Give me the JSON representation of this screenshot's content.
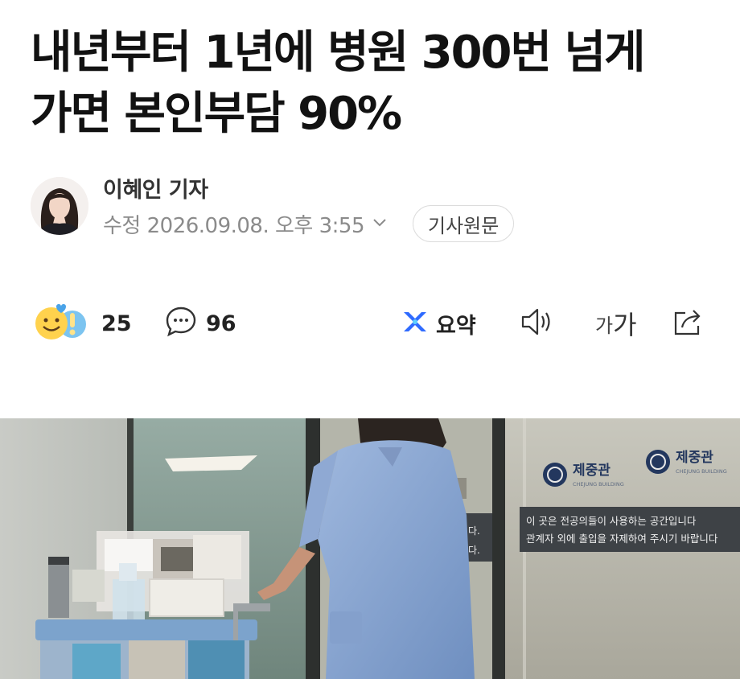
{
  "article": {
    "headline_line1": "내년부터 1년에 병원 300번 넘게",
    "headline_line2": "가면 본인부담 90%"
  },
  "byline": {
    "reporter": "이혜인 기자",
    "updated": "수정 2026.09.08. 오후 3:55",
    "original_button": "기사원문"
  },
  "actions": {
    "reactions_count": "25",
    "comments_count": "96",
    "summary_label": "요약",
    "fontsize_small": "가",
    "fontsize_large": "가"
  },
  "photo": {
    "sign_name_left": "제중관",
    "sign_name_right": "제중관",
    "sign_sub": "CHEJUNG BUILDING",
    "notice_line1": "이 곳은 전공의들이 사용하는 공간입니다",
    "notice_line2": "관계자 외에 출입을 자제하여 주시기 바랍니다",
    "fragment_1": "다.",
    "fragment_2": "다."
  },
  "colors": {
    "accent_summary": "#2f6bff",
    "text_primary": "#121212",
    "text_muted": "#8b8b8b"
  },
  "icons": [
    "reaction-emoji-icon",
    "comment-icon",
    "summary-logo-icon",
    "speaker-icon",
    "share-icon",
    "chevron-down-icon"
  ]
}
